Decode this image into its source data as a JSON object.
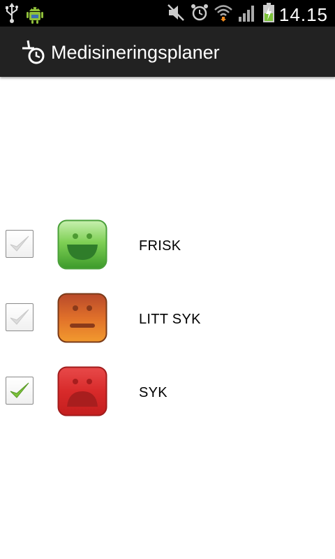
{
  "status_bar": {
    "time": "14.15",
    "icons": [
      "usb-icon",
      "android-debug-icon",
      "mute-icon",
      "alarm-icon",
      "wifi-icon",
      "signal-icon",
      "battery-charging-icon"
    ]
  },
  "action_bar": {
    "title": "Medisineringsplaner",
    "icon": "medication-timer-icon"
  },
  "conditions": [
    {
      "label": "FRISK",
      "checked": false,
      "face": "happy-face-icon",
      "color": "#5cb83e"
    },
    {
      "label": "LITT SYK",
      "checked": false,
      "face": "neutral-face-icon",
      "color": "#d9691f"
    },
    {
      "label": "SYK",
      "checked": true,
      "face": "sad-face-icon",
      "color": "#d92424"
    }
  ],
  "colors": {
    "action_bar_bg": "#222222",
    "check_active": "#7cc23a",
    "check_inactive": "#dcdcdc"
  }
}
